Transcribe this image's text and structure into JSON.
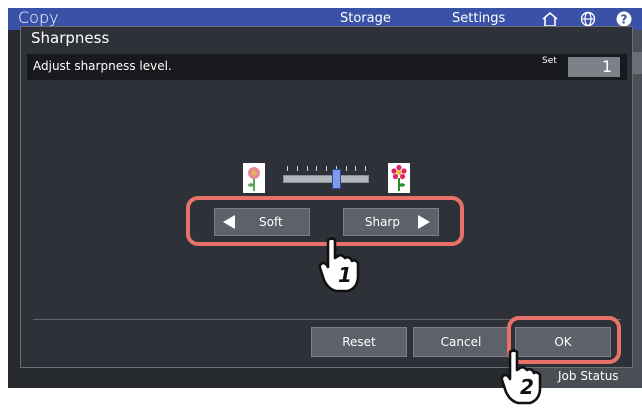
{
  "app": {
    "title": "Copy",
    "tabs": [
      "Storage",
      "Settings"
    ],
    "job_status": "Job Status"
  },
  "dialog": {
    "title": "Sharpness",
    "instruction": "Adjust sharpness level.",
    "set_label": "Set",
    "set_value": "1",
    "slider": {
      "positions": 9,
      "current_index": 5
    },
    "soft_label": "Soft",
    "sharp_label": "Sharp",
    "reset_label": "Reset",
    "cancel_label": "Cancel",
    "ok_label": "OK"
  },
  "callouts": {
    "step1": "1",
    "step2": "2"
  },
  "colors": {
    "header_blue": "#3a51a8",
    "dialog_bg": "#2e3137",
    "button_gray": "#5d6169",
    "callout": "#e8726a",
    "slider_knob": "#7f9bea"
  },
  "icons": [
    "home-icon",
    "globe-icon",
    "help-icon",
    "arrow-left-icon",
    "arrow-right-icon",
    "flower-soft-icon",
    "flower-sharp-icon",
    "hand-pointer-icon"
  ]
}
